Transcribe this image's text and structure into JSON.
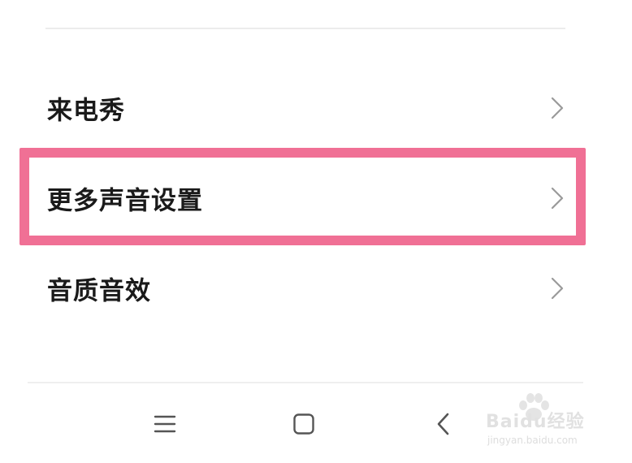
{
  "settings": {
    "items": [
      {
        "label": "来电秀",
        "icon": "chevron-right-icon"
      },
      {
        "label": "更多声音设置",
        "icon": "chevron-right-icon",
        "highlighted": true
      },
      {
        "label": "音质音效",
        "icon": "chevron-right-icon"
      }
    ]
  },
  "highlight": {
    "color": "#f07095"
  },
  "navbar": {
    "buttons": [
      {
        "name": "menu-icon"
      },
      {
        "name": "home-icon"
      },
      {
        "name": "back-icon"
      }
    ]
  },
  "watermark": {
    "line1": "Baidu经验",
    "line2": "jingyan.baidu.com"
  }
}
